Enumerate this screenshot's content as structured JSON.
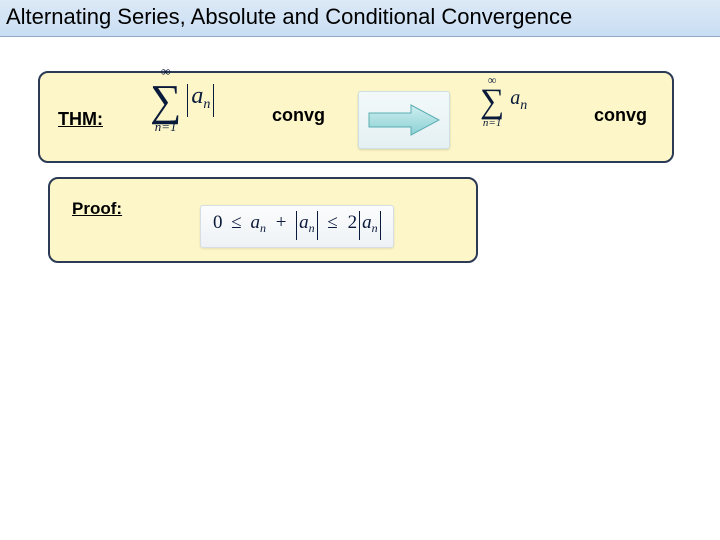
{
  "title": "Alternating Series, Absolute and Conditional Convergence",
  "thm": {
    "label": "THM:",
    "sum1": {
      "upper": "∞",
      "lower": "n=1",
      "var": "a",
      "sub": "n"
    },
    "convg1": "convg",
    "sum2": {
      "upper": "∞",
      "lower": "n=1",
      "var": "a",
      "sub": "n"
    },
    "convg2": "convg"
  },
  "proof": {
    "label": "Proof:",
    "ineq": {
      "zero": "0",
      "le1": "≤",
      "a": "a",
      "an_sub": "n",
      "plus": "+",
      "le2": "≤",
      "two": "2"
    }
  }
}
